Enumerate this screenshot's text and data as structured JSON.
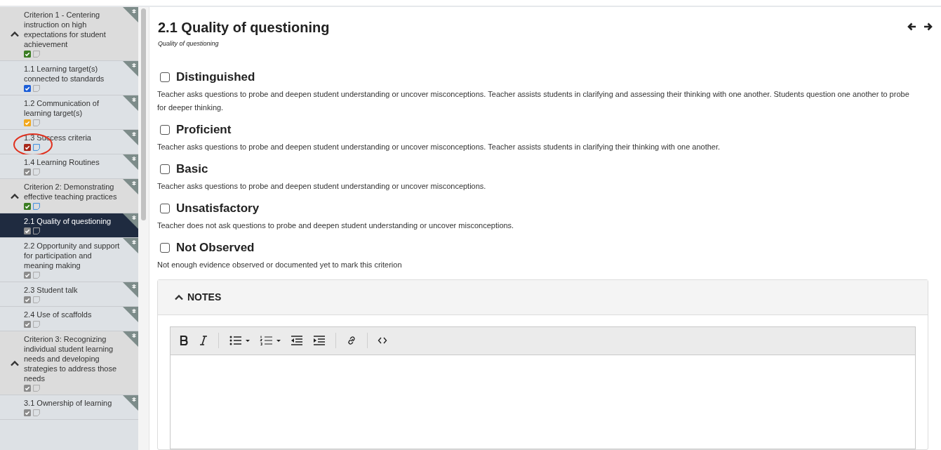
{
  "sidebar": {
    "items": [
      {
        "kind": "criterion",
        "title": "Criterion 1 - Centering instruction on high expectations for student achievement",
        "color": "#3b7d23",
        "has_note": false,
        "selected": false,
        "circled": false
      },
      {
        "kind": "element",
        "title": "1.1 Learning target(s) connected to standards",
        "color": "#1d5fd8",
        "has_note": false,
        "selected": false,
        "circled": false
      },
      {
        "kind": "element",
        "title": "1.2 Communication of learning target(s)",
        "color": "#f2a81d",
        "has_note": false,
        "selected": false,
        "circled": false
      },
      {
        "kind": "element",
        "title": "1.3 Success criteria",
        "color": "#a8281a",
        "has_note": true,
        "selected": false,
        "circled": true
      },
      {
        "kind": "element",
        "title": "1.4 Learning Routines",
        "color": "#8c8c8c",
        "has_note": false,
        "selected": false,
        "circled": false
      },
      {
        "kind": "criterion",
        "title": "Criterion 2: Demonstrating effective teaching practices",
        "color": "#3b7d23",
        "has_note": true,
        "selected": false,
        "circled": false
      },
      {
        "kind": "element",
        "title": "2.1 Quality of questioning",
        "color": "#8c8c8c",
        "has_note": false,
        "selected": true,
        "circled": false
      },
      {
        "kind": "element",
        "title": "2.2 Opportunity and support for participation and meaning making",
        "color": "#8c8c8c",
        "has_note": false,
        "selected": false,
        "circled": false
      },
      {
        "kind": "element",
        "title": "2.3 Student talk",
        "color": "#8c8c8c",
        "has_note": false,
        "selected": false,
        "circled": false
      },
      {
        "kind": "element",
        "title": "2.4 Use of scaffolds",
        "color": "#8c8c8c",
        "has_note": false,
        "selected": false,
        "circled": false
      },
      {
        "kind": "criterion",
        "title": "Criterion 3: Recognizing individual student learning needs and developing strategies to address those needs",
        "color": "#8c8c8c",
        "has_note": false,
        "selected": false,
        "circled": false
      },
      {
        "kind": "element",
        "title": "3.1 Ownership of learning",
        "color": "#8c8c8c",
        "has_note": false,
        "selected": false,
        "circled": false
      }
    ]
  },
  "page": {
    "title": "2.1 Quality of questioning",
    "subtitle": "Quality of questioning"
  },
  "ratings": [
    {
      "label": "Distinguished",
      "checked": false,
      "description": "Teacher asks questions to probe and deepen student understanding or uncover misconceptions. Teacher assists students in clarifying and assessing their thinking with one another. Students question one another to probe for deeper thinking."
    },
    {
      "label": "Proficient",
      "checked": false,
      "description": "Teacher asks questions to probe and deepen student understanding or uncover misconceptions. Teacher assists students in clarifying their thinking with one another."
    },
    {
      "label": "Basic",
      "checked": false,
      "description": "Teacher asks questions to probe and deepen student understanding or uncover misconceptions."
    },
    {
      "label": "Unsatisfactory",
      "checked": false,
      "description": "Teacher does not ask questions to probe and deepen student understanding or uncover misconceptions."
    },
    {
      "label": "Not Observed",
      "checked": false,
      "description": "Not enough evidence observed or documented yet to mark this criterion"
    }
  ],
  "notes": {
    "title": "NOTES",
    "expanded": true
  }
}
